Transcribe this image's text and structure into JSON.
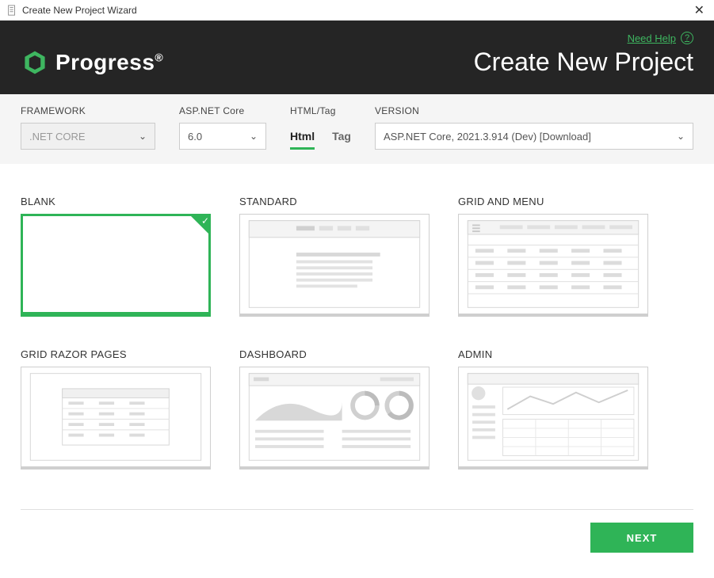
{
  "window": {
    "title": "Create New Project Wizard"
  },
  "header": {
    "need_help": "Need Help",
    "brand": "Progress",
    "page_title": "Create New Project"
  },
  "config": {
    "framework": {
      "label": "FRAMEWORK",
      "value": ".NET CORE"
    },
    "aspnet": {
      "label": "ASP.NET Core",
      "value": "6.0"
    },
    "htmltag": {
      "label": "HTML/Tag",
      "tab_html": "Html",
      "tab_tag": "Tag"
    },
    "version": {
      "label": "VERSION",
      "value": "ASP.NET Core, 2021.3.914 (Dev) [Download]"
    }
  },
  "templates": {
    "blank": "BLANK",
    "standard": "STANDARD",
    "grid_menu": "GRID AND MENU",
    "grid_razor": "GRID RAZOR PAGES",
    "dashboard": "DASHBOARD",
    "admin": "ADMIN"
  },
  "footer": {
    "next": "NEXT"
  }
}
